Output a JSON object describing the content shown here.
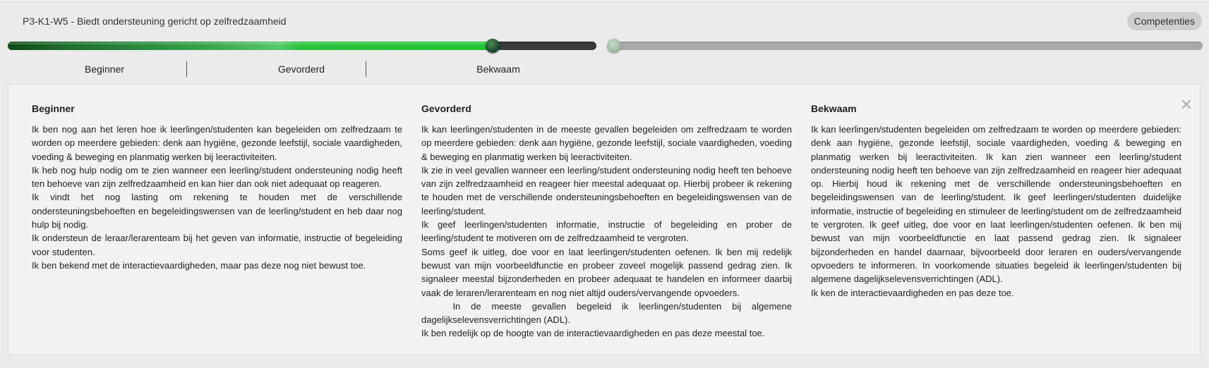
{
  "header": {
    "title": "P3-K1-W5 - Biedt ondersteuning gericht op zelfredzaamheid",
    "competenties_label": "Competenties"
  },
  "slider": {
    "left_value": 0.824,
    "right_value": 0
  },
  "levels": [
    "Beginner",
    "Gevorderd",
    "Bekwaam"
  ],
  "panel": {
    "columns": [
      {
        "heading": "Beginner",
        "lines": [
          "Ik ben nog aan het leren hoe ik leerlingen/studenten kan begeleiden om zelfredzaam te worden op meerdere gebieden: denk aan hygiëne, gezonde leefstijl, sociale vaardigheden, voeding & beweging en planmatig werken bij leeractiviteiten.",
          "Ik heb nog hulp nodig om te zien wanneer een leerling/student ondersteuning nodig heeft ten behoeve van zijn zelfredzaamheid en kan hier dan ook niet adequaat op reageren.",
          "Ik vindt het nog lasting om rekening te houden met de verschillende ondersteuningsbehoeften en begeleidingswensen van de leerling/student en heb daar nog hulp bij nodig.",
          "Ik ondersteun de leraar/lerarenteam bij het geven van informatie, instructie of begeleiding  voor studenten.",
          "Ik ben bekend met de interactievaardigheden, maar pas deze nog niet bewust toe."
        ]
      },
      {
        "heading": "Gevorderd",
        "lines": [
          "Ik kan leerlingen/studenten in de meeste gevallen begeleiden om zelfredzaam te worden op meerdere gebieden: denk aan hygiëne, gezonde leefstijl, sociale vaardigheden, voeding & beweging en planmatig werken bij leeractiviteiten.",
          "Ik zie in veel gevallen wanneer een leerling/student ondersteuning nodig heeft ten behoeve van zijn zelfredzaamheid en reageer hier meestal adequaat op. Hierbij probeer ik rekening te houden met de verschillende ondersteuningsbehoeften en begeleidingswensen van de leerling/student.",
          "Ik geef leerlingen/studenten informatie, instructie of begeleiding en prober de leerling/student te motiveren om de zelfredzaamheid te vergroten.",
          "Soms geef ik uitleg, doe voor en laat leerlingen/studenten oefenen. Ik ben mij redelijk bewust van mijn voorbeeldfunctie en probeer zoveel mogelijk passend gedrag zien. Ik signaleer meestal bijzonderheden en probeer adequaat te handelen en informeer daarbij vaak  de leraren/lerarenteam en nog niet altijd ouders/vervangende opvoeders.",
          "   In de meeste gevallen begeleid ik leerlingen/studenten bij algemene dagelijkselevensverrichtingen (ADL).",
          "Ik ben redelijk op de hoogte van de interactievaardigheden en pas deze meestal toe."
        ]
      },
      {
        "heading": "Bekwaam",
        "lines": [
          "Ik kan leerlingen/studenten begeleiden om zelfredzaam te worden op meerdere gebieden: denk aan hygiëne, gezonde leefstijl, sociale vaardigheden, voeding & beweging en planmatig werken bij leeractiviteiten. Ik kan zien wanneer een leerling/student ondersteuning nodig heeft ten behoeve van zijn zelfredzaamheid en reageer hier adequaat op. Hierbij houd ik rekening met de verschillende ondersteuningsbehoeften en begeleidingswensen van de leerling/student. Ik geef leerlingen/studenten duidelijke informatie, instructie of begeleiding en stimuleer de leerling/student om de zelfredzaamheid te vergroten. Ik geef uitleg, doe voor en laat leerlingen/studenten oefenen. Ik ben mij bewust van mijn voorbeeldfunctie en laat passend gedrag zien. Ik signaleer bijzonderheden en handel daarnaar, bijvoorbeeld door leraren en ouders/vervangende opvoeders te informeren. In voorkomende situaties begeleid ik leerlingen/studenten bij algemene dagelijkselevensverrichtingen (ADL).",
          "Ik ken de interactievaardigheden en pas deze toe."
        ]
      }
    ]
  },
  "icons": {
    "close": "close-icon"
  },
  "colors": {
    "fill_green": "#20c535",
    "fill_dark_green": "#0f4a1c",
    "track_dark": "#3b3b3b",
    "track_grey": "#a9a9a9"
  }
}
